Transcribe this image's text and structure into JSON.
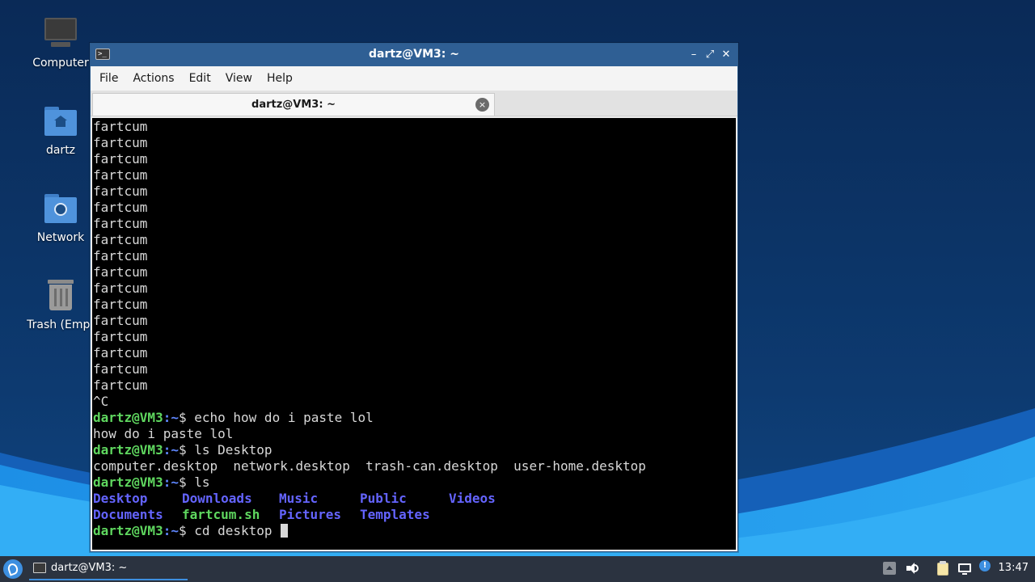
{
  "desktop": {
    "icons": [
      {
        "label": "Computer",
        "icon": "monitor-icon"
      },
      {
        "label": "dartz",
        "icon": "home-folder-icon"
      },
      {
        "label": "Network",
        "icon": "network-folder-icon"
      },
      {
        "label": "Trash (Empt",
        "icon": "trash-icon"
      }
    ]
  },
  "window": {
    "title": "dartz@VM3: ~",
    "controls": {
      "minimize": "–",
      "maximize": "⤢",
      "close": "✕"
    },
    "menu": [
      "File",
      "Actions",
      "Edit",
      "View",
      "Help"
    ],
    "tab": {
      "label": "dartz@VM3: ~",
      "close_glyph": "×"
    }
  },
  "terminal": {
    "prompt_user": "dartz@VM3",
    "prompt_path": ":~",
    "prompt_symbol": "$ ",
    "output_lines": [
      "fartcum",
      "fartcum",
      "fartcum",
      "fartcum",
      "fartcum",
      "fartcum",
      "fartcum",
      "fartcum",
      "fartcum",
      "fartcum",
      "fartcum",
      "fartcum",
      "fartcum",
      "fartcum",
      "fartcum",
      "fartcum",
      "fartcum",
      "^C"
    ],
    "cmd1": "echo how do i paste lol",
    "out1": "how do i paste lol",
    "cmd2": "ls Desktop",
    "out2": "computer.desktop  network.desktop  trash-can.desktop  user-home.desktop",
    "cmd3": "ls",
    "ls_row1": [
      "Desktop",
      "Downloads",
      "Music",
      "Public",
      "Videos"
    ],
    "ls_row2": [
      "Documents",
      "fartcum.sh",
      "Pictures",
      "Templates"
    ],
    "cmd4": "cd desktop "
  },
  "taskbar": {
    "task_label": "dartz@VM3: ~",
    "tray_icons": [
      "up-arrow-icon",
      "volume-icon",
      "clipboard-icon",
      "network-icon",
      "notification-icon"
    ],
    "clock": "13:47"
  },
  "colors": {
    "prompt_green": "#5fd75f",
    "directory_blue": "#6464ff",
    "titlebar": "#2f5f94",
    "taskbar": "#2b3340"
  }
}
